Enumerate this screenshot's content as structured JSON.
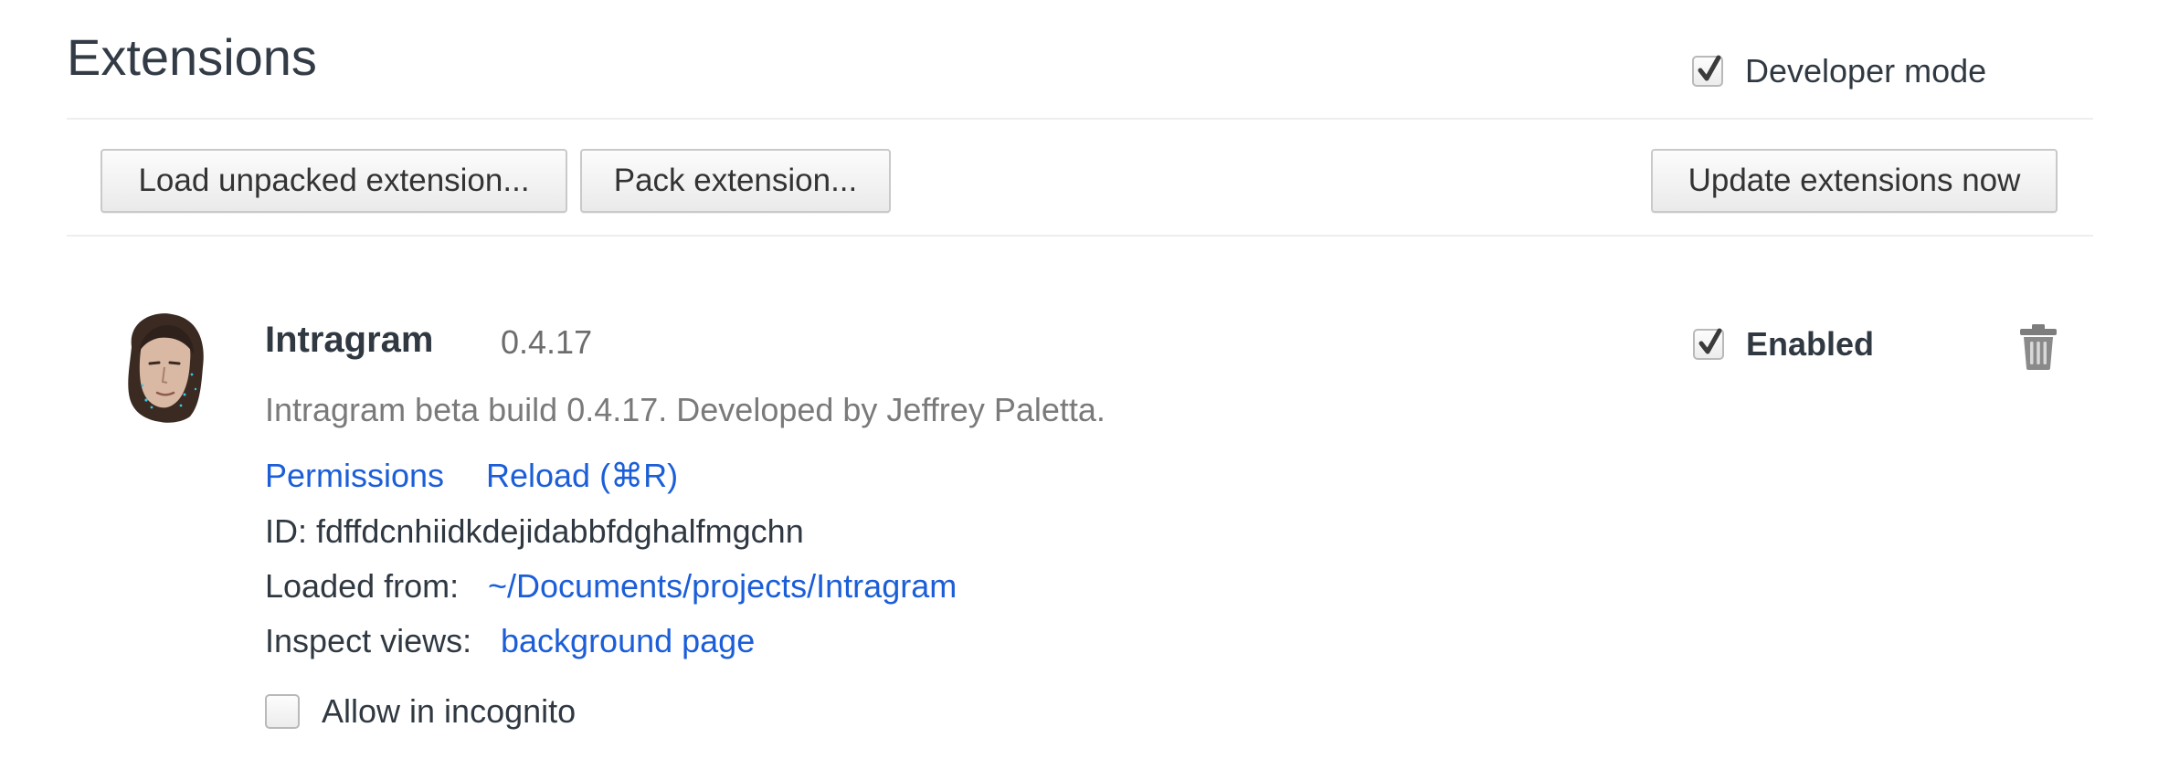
{
  "header": {
    "title": "Extensions",
    "developer_mode": {
      "label": "Developer mode",
      "checked": true
    }
  },
  "toolbar": {
    "load_unpacked_label": "Load unpacked extension...",
    "pack_label": "Pack extension...",
    "update_label": "Update extensions now"
  },
  "extension": {
    "name": "Intragram",
    "version": "0.4.17",
    "description": "Intragram beta build 0.4.17. Developed by Jeffrey Paletta.",
    "links": {
      "permissions": "Permissions",
      "reload": "Reload (⌘R)"
    },
    "id_line": "ID: fdffdcnhiidkdejidabbfdghalfmgchn",
    "loaded_from_label": "Loaded from:",
    "loaded_from_path": "~/Documents/projects/Intragram",
    "inspect_views_label": "Inspect views:",
    "inspect_views_link": "background page",
    "incognito": {
      "label": "Allow in incognito",
      "checked": false
    },
    "enabled": {
      "label": "Enabled",
      "checked": true
    },
    "icons": {
      "avatar": "avatar-image",
      "delete": "trash-icon"
    }
  },
  "colors": {
    "link": "#1b5ed8",
    "text": "#303942",
    "muted": "#7a7a7a"
  }
}
